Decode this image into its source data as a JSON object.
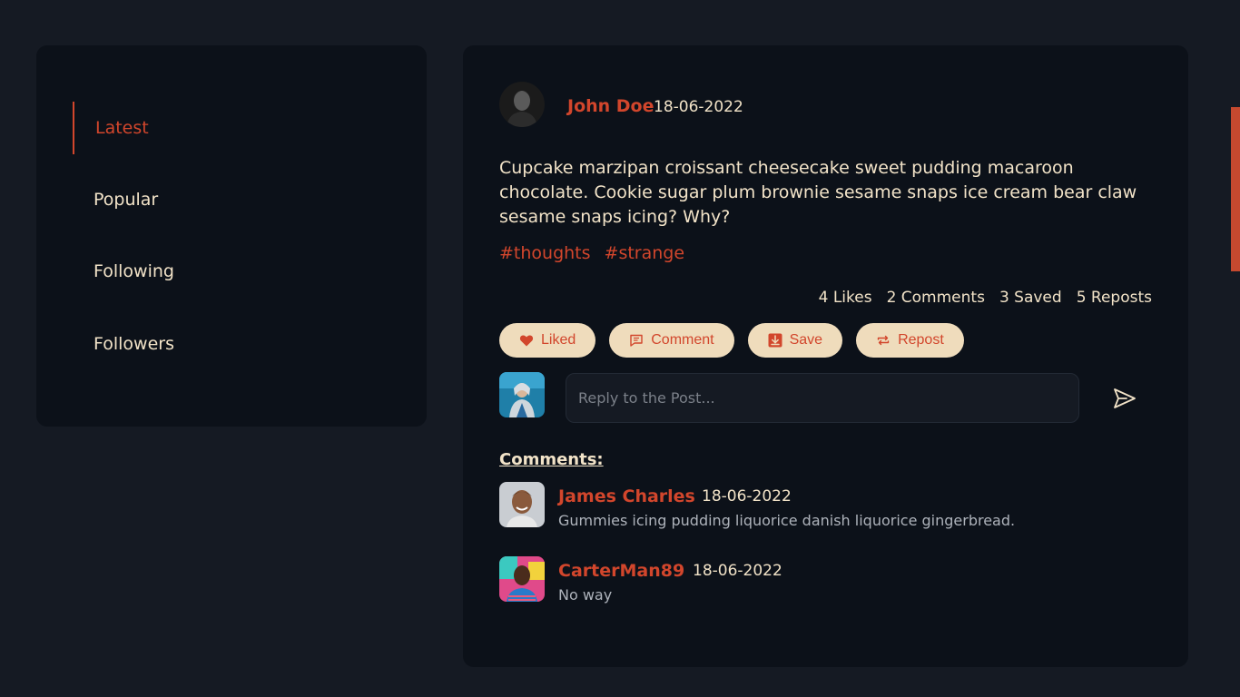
{
  "nav": {
    "items": [
      {
        "label": "Latest",
        "active": true
      },
      {
        "label": "Popular",
        "active": false
      },
      {
        "label": "Following",
        "active": false
      },
      {
        "label": "Followers",
        "active": false
      }
    ]
  },
  "post": {
    "author": "John Doe",
    "date": "18-06-2022",
    "body": "Cupcake marzipan croissant cheesecake sweet pudding macaroon chocolate. Cookie sugar plum brownie sesame snaps ice cream bear claw sesame snaps icing? Why?",
    "tags": [
      "#thoughts",
      "#strange"
    ],
    "stats": {
      "likes": "4 Likes",
      "comments": "2 Comments",
      "saved": "3 Saved",
      "reposts": "5 Reposts"
    },
    "actions": {
      "like_label": "Liked",
      "comment_label": "Comment",
      "save_label": "Save",
      "repost_label": "Repost"
    }
  },
  "reply": {
    "placeholder": "Reply to the Post...",
    "value": ""
  },
  "comments": {
    "heading": "Comments:",
    "items": [
      {
        "name": "James Charles",
        "date": "18-06-2022",
        "text": "Gummies icing pudding liquorice danish liquorice gingerbread."
      },
      {
        "name": "CarterMan89",
        "date": "18-06-2022",
        "text": "No way"
      }
    ]
  },
  "colors": {
    "background": "#151a23",
    "panel": "#0c1119",
    "accent": "#d2462c",
    "text": "#f2e3c8",
    "button_bg": "#efdcbc",
    "muted": "#aeb3bb"
  },
  "icons": {
    "like": "heart-icon",
    "comment": "comment-icon",
    "save": "download-icon",
    "repost": "repost-icon",
    "send": "send-icon"
  }
}
